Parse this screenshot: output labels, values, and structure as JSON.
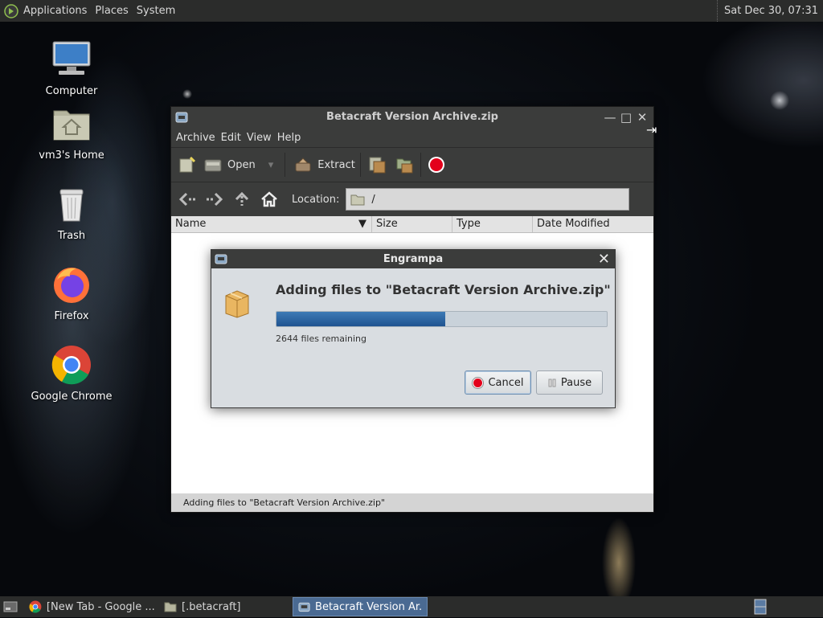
{
  "top_panel": {
    "menus": [
      "Applications",
      "Places",
      "System"
    ],
    "clock": "Sat Dec 30, 07:31"
  },
  "desktop_icons": [
    {
      "label": "Computer",
      "icon": "computer-icon"
    },
    {
      "label": "vm3's Home",
      "icon": "home-folder-icon"
    },
    {
      "label": "Trash",
      "icon": "trash-icon"
    },
    {
      "label": "Firefox",
      "icon": "firefox-icon"
    },
    {
      "label": "Google Chrome",
      "icon": "chrome-icon"
    }
  ],
  "archive_window": {
    "title": "Betacraft Version Archive.zip",
    "menu": [
      "Archive",
      "Edit",
      "View",
      "Help"
    ],
    "toolbar": {
      "open_label": "Open",
      "extract_label": "Extract"
    },
    "location_label": "Location:",
    "location_value": "/",
    "columns": [
      "Name",
      "Size",
      "Type",
      "Date Modified"
    ],
    "status": "Adding files to \"Betacraft Version Archive.zip\""
  },
  "dialog": {
    "title": "Engrampa",
    "heading": "Adding files to \"Betacraft Version Archive.zip\"",
    "progress_fraction": 0.51,
    "remaining": "2644 files remaining",
    "cancel_label": "Cancel",
    "pause_label": "Pause"
  },
  "taskbar": {
    "items": [
      {
        "label": "[New Tab - Google ...",
        "icon": "chrome-icon"
      },
      {
        "label": "[.betacraft]",
        "icon": "folder-icon"
      },
      {
        "label": "Betacraft Version Ar...",
        "icon": "archive-icon"
      }
    ]
  },
  "colors": {
    "panel": "#2b2c2b",
    "progress_fill": "#2a65a3",
    "dialog_bg": "#d9dde1",
    "active_task": "#4a6a92"
  }
}
